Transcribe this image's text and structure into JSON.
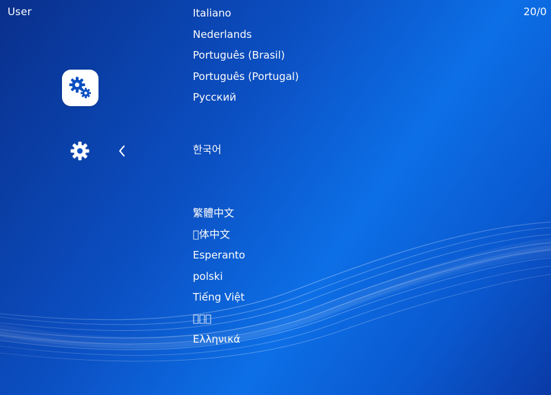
{
  "header": {
    "user": "User",
    "datetime": "20/0"
  },
  "icons": {
    "category": "settings-category-icon",
    "settings": "gear-icon",
    "back": "chevron-left-icon"
  },
  "colors": {
    "background_dark": "#0a2f8c",
    "background_light": "#0d6fe6",
    "text": "#ffffff",
    "icon_accent": "#0b4fc2"
  },
  "languages": {
    "italiano": "Italiano",
    "nederlands": "Nederlands",
    "pt_br": "Português (Brasil)",
    "pt_pt": "Português (Portugal)",
    "russian": "Русский",
    "korean": "한국어",
    "zh_trad": "繁體中文",
    "zh_simp": "􏿾体中文",
    "esperanto": "Esperanto",
    "polski": "polski",
    "vietnamese": "Tiếng Việt",
    "arabic": "􏿾􏿾􏿾",
    "greek": "Ελληνικά"
  },
  "selected_language": "한국어"
}
